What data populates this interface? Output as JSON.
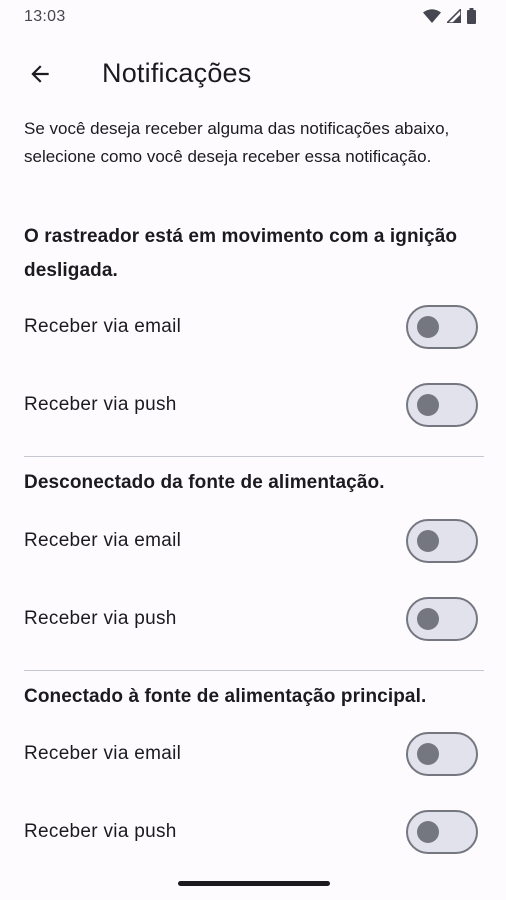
{
  "status_bar": {
    "time": "13:03"
  },
  "app_bar": {
    "title": "Notificações"
  },
  "intro": "Se você deseja receber alguma das notificações abaixo, selecione como você deseja receber essa notificação.",
  "sections": [
    {
      "title": "O rastreador está em movimento com a ignição desligada.",
      "options": [
        {
          "label": "Receber via email",
          "enabled": false
        },
        {
          "label": "Receber via push",
          "enabled": false
        }
      ]
    },
    {
      "title": "Desconectado da fonte de alimentação.",
      "options": [
        {
          "label": "Receber via email",
          "enabled": false
        },
        {
          "label": "Receber via push",
          "enabled": false
        }
      ]
    },
    {
      "title": "Conectado à fonte de alimentação principal.",
      "options": [
        {
          "label": "Receber via email",
          "enabled": false
        },
        {
          "label": "Receber via push",
          "enabled": false
        }
      ]
    }
  ]
}
